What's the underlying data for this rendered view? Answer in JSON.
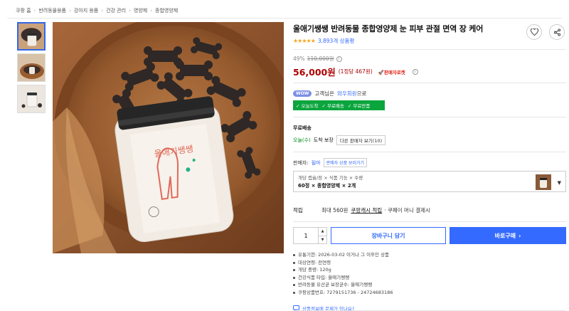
{
  "breadcrumb": [
    "쿠팡 홈",
    "반려동물용품",
    "강아지 용품",
    "건강 관리",
    "영양제",
    "종합영양제"
  ],
  "product": {
    "title": "울애기쌩쌩 반려동물 종합영양제 눈 피부 관절 면역 장 케어",
    "stars": "★★★★★",
    "review_count": "3,893개 상품평"
  },
  "price": {
    "discount_rate": "49%",
    "original": "110,000원",
    "sale": "56,000원",
    "unit_price": "(1정당 467원)",
    "seller_rocket": "판매자로켓"
  },
  "wow": {
    "badge": "WOW",
    "pre": "고객님은",
    "link": "와우회원",
    "post": "으로",
    "benefits": [
      "✓ 오늘도착",
      "✓ 무료배송",
      "✓ 무료반품"
    ]
  },
  "delivery": {
    "label": "무료배송",
    "arrival_day": "오늘(수)",
    "arrival_text": "도착 보장",
    "other_seller": "다른 판매자 보기(10)"
  },
  "seller": {
    "label": "판매자:",
    "name": "될마",
    "button": "판매자 상품 보러가기"
  },
  "option": {
    "label": "개당 캡슐/정 × 식품 기능 × 수량",
    "value": "60정 × 종합영양제 × 2개"
  },
  "points": {
    "label": "적립",
    "pre": "최대 560원",
    "link": "쿠팡캐시 적립",
    "post": "· 쿠페이 머니 결제시"
  },
  "purchase": {
    "quantity": "1",
    "cart_label": "장바구니 담기",
    "buy_label": "바로구매",
    "buy_arrow": "›"
  },
  "specs": [
    "유통기한: 2026-03-02 이거나 그 이후인 상품",
    "대상연령: 전연령",
    "개당 중량: 120g",
    "건강식품 타입: 울애기쌩쌩",
    "반려동물 유산균 보장균수: 울애기쌩쌩",
    "쿠팡상품번호: 7279151736 - 24724683186"
  ],
  "report_link": "상품정보에 문제가 있나요?",
  "jar": {
    "brand": "울애기쌩쌩"
  },
  "colors": {
    "accent": "#346aff",
    "price": "#ae0000",
    "green_badge": "#0aa53d"
  }
}
